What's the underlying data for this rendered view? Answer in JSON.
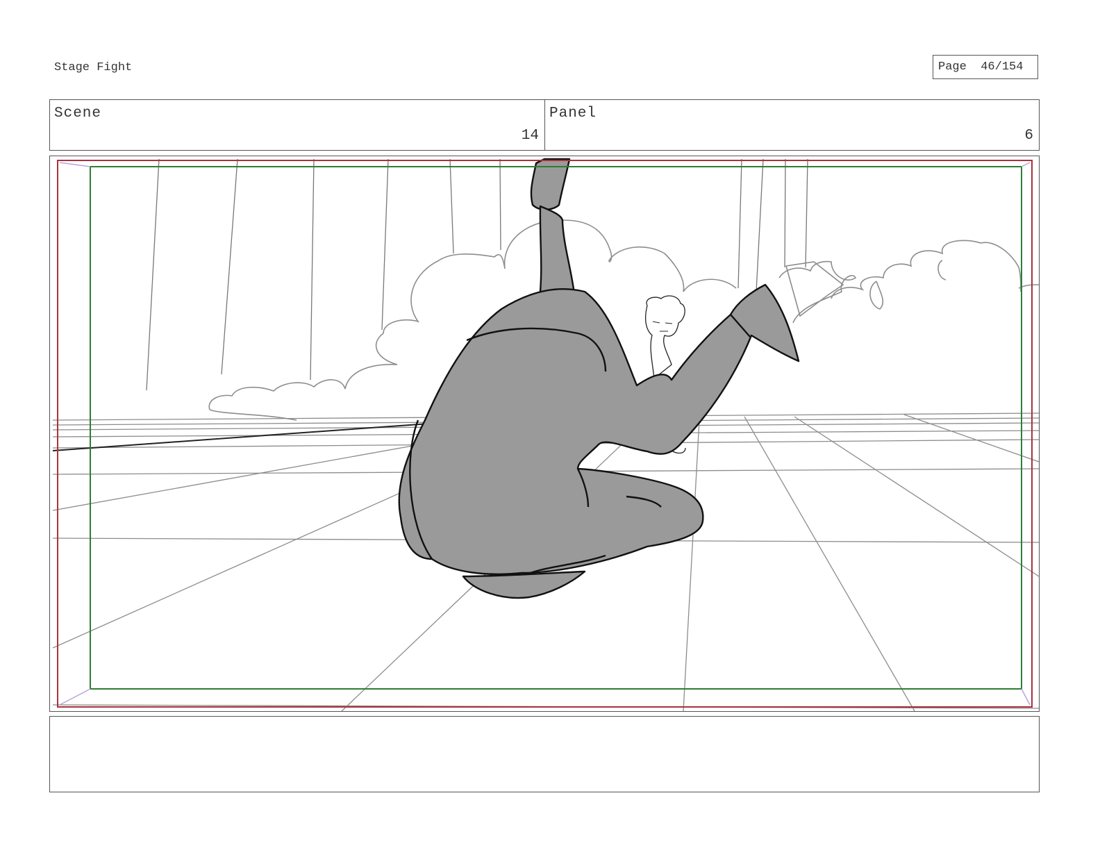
{
  "header": {
    "project_title": "Stage Fight",
    "page_label": "Page",
    "page_number": "46/154"
  },
  "scene": {
    "label": "Scene",
    "value": "14"
  },
  "panel": {
    "label": "Panel",
    "value": "6"
  },
  "notes": {
    "text": ""
  },
  "colors": {
    "safe_area_outer": "#a8323c",
    "safe_area_inner": "#2e7d32",
    "figure_fill": "#9a9a9a",
    "sketch_line": "#8c8c8c",
    "ink_line": "#111111"
  }
}
